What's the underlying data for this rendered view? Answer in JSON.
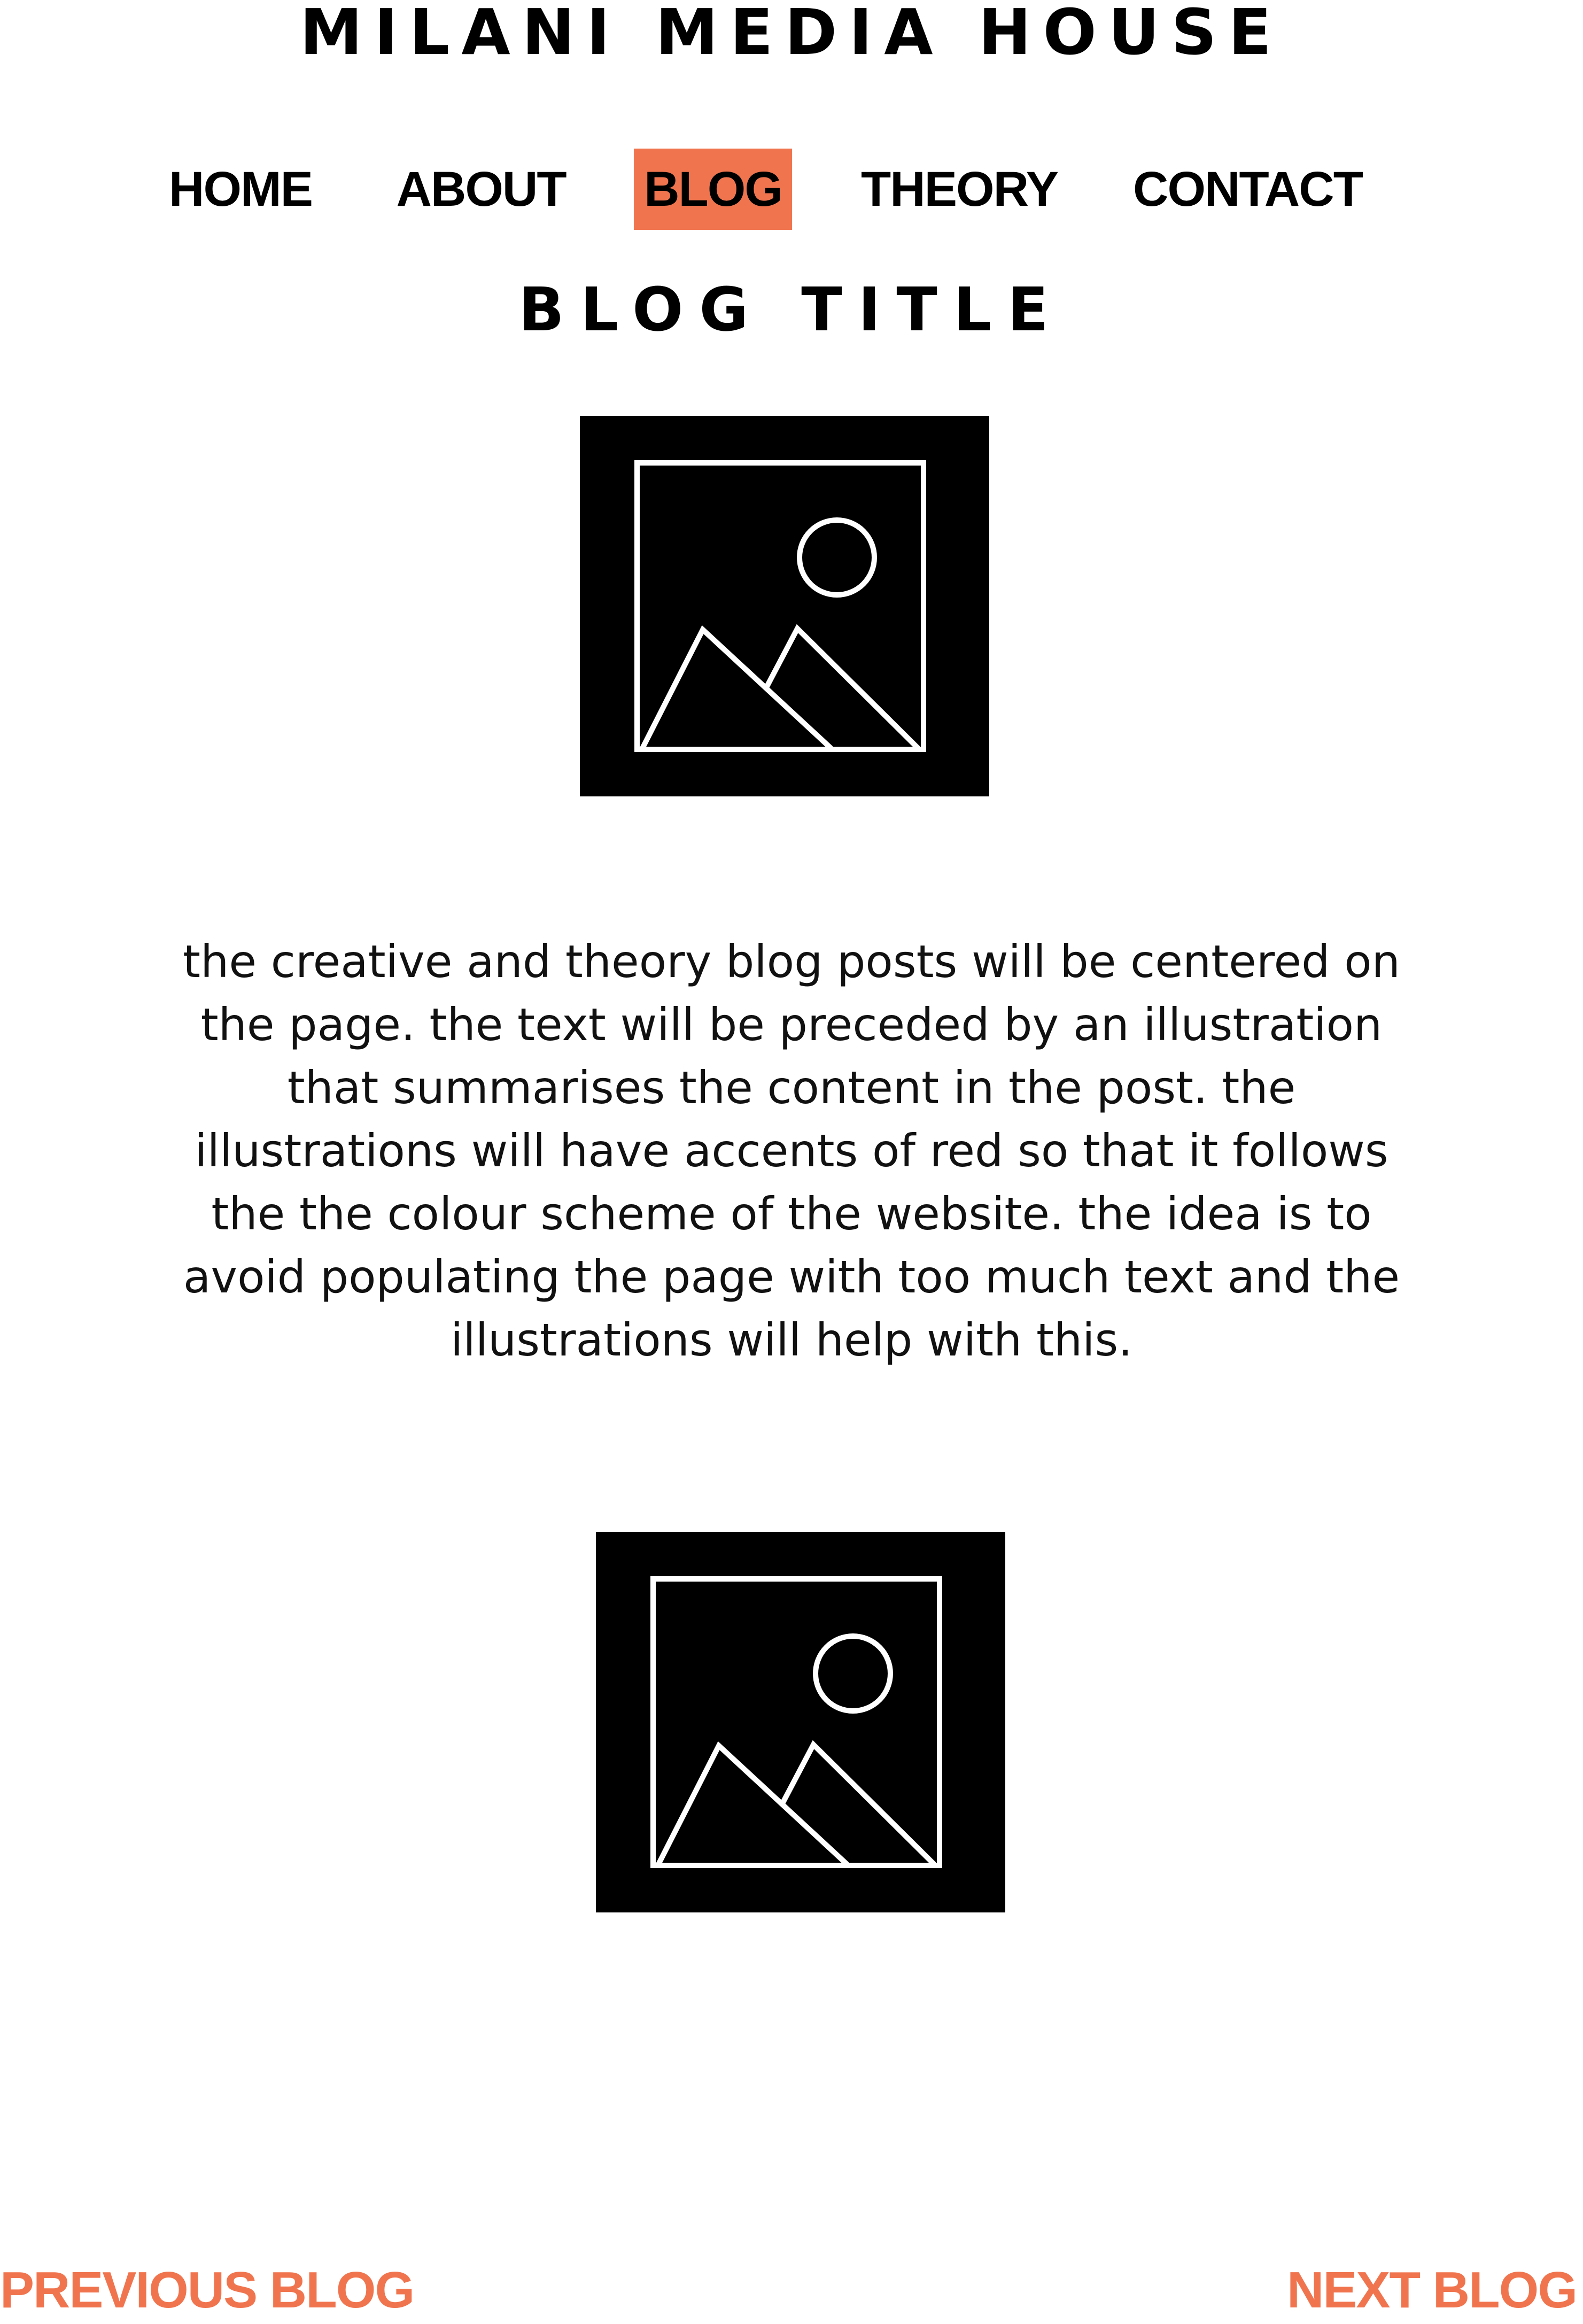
{
  "site": {
    "title": "MILANI MEDIA HOUSE"
  },
  "nav": {
    "items": [
      {
        "label": "HOME",
        "active": false
      },
      {
        "label": "ABOUT",
        "active": false
      },
      {
        "label": "BLOG",
        "active": true
      },
      {
        "label": "THEORY",
        "active": false
      },
      {
        "label": "CONTACT",
        "active": false
      }
    ]
  },
  "post": {
    "title": "BLOG TITLE",
    "body": "the creative and theory blog posts will be centered on the page. the text will be preceded by an illustration that summarises the content in the post. the illustrations will have accents of red so that it follows the the colour scheme of the website. the idea is to avoid populating the page with too much text and the illustrations will help with this.",
    "images": [
      {
        "icon": "image-placeholder-icon"
      },
      {
        "icon": "image-placeholder-icon"
      }
    ]
  },
  "pager": {
    "previous_label": "PREVIOUS BLOG",
    "next_label": "NEXT BLOG"
  },
  "colors": {
    "accent": "#f0754f",
    "text": "#000000",
    "background": "#ffffff"
  }
}
